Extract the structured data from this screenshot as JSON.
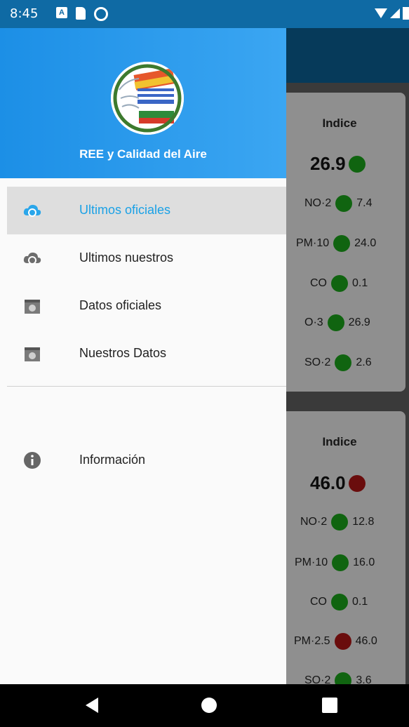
{
  "status_bar": {
    "time": "8:45",
    "a_icon": "A"
  },
  "drawer": {
    "title": "REE y Calidad del Aire",
    "items": [
      {
        "label": "Ultimos oficiales",
        "icon": "cloud-sync-icon",
        "active": true
      },
      {
        "label": "Ultimos nuestros",
        "icon": "cloud-sync-icon",
        "active": false
      },
      {
        "label": "Datos oficiales",
        "icon": "calendar-icon",
        "active": false
      },
      {
        "label": "Nuestros Datos",
        "icon": "calendar-icon",
        "active": false
      }
    ],
    "info_item": {
      "label": "Información",
      "icon": "info-icon"
    }
  },
  "cards": [
    {
      "title": "Indice",
      "value": "26.9",
      "value_color": "#1a9a1a",
      "rows": [
        {
          "label": "NO·2",
          "value": "7.4",
          "color": "#1a9a1a"
        },
        {
          "label": "PM·10",
          "value": "24.0",
          "color": "#1a9a1a"
        },
        {
          "label": "CO",
          "value": "0.1",
          "color": "#1a9a1a"
        },
        {
          "label": "O·3",
          "value": "26.9",
          "color": "#1a9a1a"
        },
        {
          "label": "SO·2",
          "value": "2.6",
          "color": "#1a9a1a"
        }
      ]
    },
    {
      "title": "Indice",
      "value": "46.0",
      "value_color": "#a31515",
      "rows": [
        {
          "label": "NO·2",
          "value": "12.8",
          "color": "#1a9a1a"
        },
        {
          "label": "PM·10",
          "value": "16.0",
          "color": "#1a9a1a"
        },
        {
          "label": "CO",
          "value": "0.1",
          "color": "#1a9a1a"
        },
        {
          "label": "PM·2.5",
          "value": "46.0",
          "color": "#a31515"
        },
        {
          "label": "SO·2",
          "value": "3.6",
          "color": "#1a9a1a"
        }
      ]
    }
  ],
  "colors": {
    "accent": "#1aa1e6",
    "good": "#1a9a1a",
    "bad": "#a31515"
  }
}
